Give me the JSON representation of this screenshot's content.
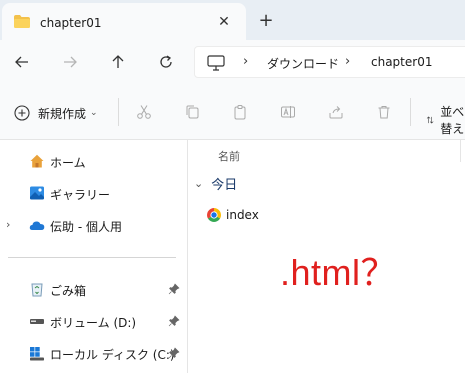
{
  "tab": {
    "title": "chapter01",
    "close": "✕",
    "new_tab": "+"
  },
  "address": {
    "crumbs": [
      "ダウンロード",
      "chapter01"
    ],
    "separator": "›"
  },
  "toolbar": {
    "new_label": "新規作成",
    "new_dropdown": "⌄",
    "sort_label": "並べ替え"
  },
  "sidebar": {
    "items": [
      {
        "label": "ホーム",
        "icon": "home-icon"
      },
      {
        "label": "ギャラリー",
        "icon": "gallery-icon"
      },
      {
        "label": "伝助 - 個人用",
        "icon": "onedrive-icon",
        "expander": "›"
      },
      {
        "label": "ごみ箱",
        "icon": "recycle-bin-icon",
        "pinned": true
      },
      {
        "label": "ボリューム (D:)",
        "icon": "drive-icon",
        "pinned": true
      },
      {
        "label": "ローカル ディスク (C:)",
        "icon": "windows-drive-icon",
        "pinned": true
      }
    ]
  },
  "content": {
    "column_name": "名前",
    "group_label": "今日",
    "group_chevron": "⌄",
    "files": [
      {
        "name": "index",
        "icon": "chrome-icon"
      }
    ]
  },
  "annotation": ".html？",
  "colors": {
    "annotation": "#e0201e",
    "titlebar_bg": "#e8eef4",
    "toolbar_bg": "#f9fafb"
  }
}
